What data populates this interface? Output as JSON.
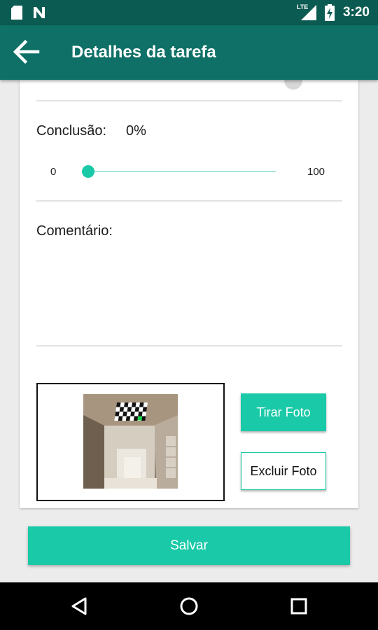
{
  "status_bar": {
    "time": "3:20",
    "network_label": "LTE",
    "icons": [
      "sd-card-icon",
      "n-notification-icon",
      "lte-signal-icon",
      "battery-charging-icon"
    ]
  },
  "app_bar": {
    "title": "Detalhes da tarefa",
    "back_icon": "arrow-left-icon"
  },
  "form": {
    "conclusion": {
      "label": "Conclusão:",
      "value_text": "0%",
      "slider": {
        "min_label": "0",
        "max_label": "100",
        "min": 0,
        "max": 100,
        "value": 0
      }
    },
    "comment": {
      "label": "Comentário:",
      "value": ""
    },
    "photo": {
      "take_photo_label": "Tirar Foto",
      "delete_photo_label": "Excluir Foto"
    }
  },
  "save_label": "Salvar",
  "colors": {
    "status_bar": "#0c5b52",
    "app_bar": "#0e7066",
    "accent": "#19c9a7",
    "track": "#a6e4d9"
  },
  "nav_bar": {
    "icons": [
      "back-triangle-icon",
      "home-circle-icon",
      "recents-square-icon"
    ]
  }
}
